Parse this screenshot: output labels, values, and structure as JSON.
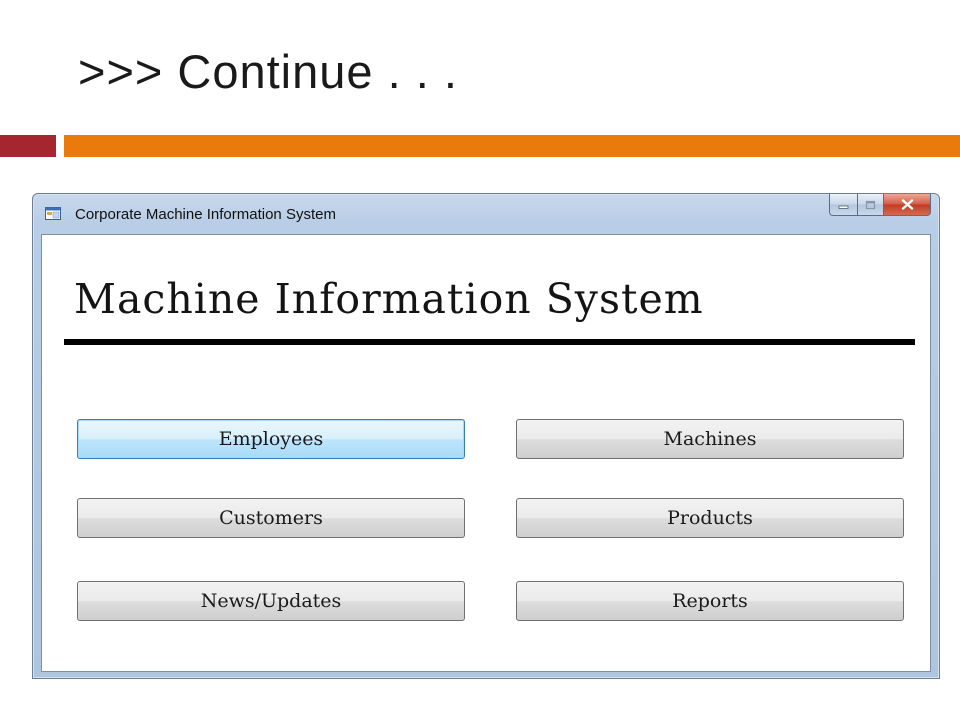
{
  "slide": {
    "title": ">>> Continue . . .",
    "colors": {
      "accent_left": "#a6262f",
      "accent_right": "#ea7a0c"
    }
  },
  "window": {
    "title": "Corporate Machine Information System",
    "app_icon": "application-form-icon",
    "controls": {
      "minimize_icon": "minimize-icon",
      "maximize_icon": "maximize-icon",
      "close_icon": "close-icon"
    }
  },
  "app": {
    "heading": "Machine Information System",
    "buttons": {
      "employees": "Employees",
      "machines": "Machines",
      "customers": "Customers",
      "products": "Products",
      "news_updates": "News/Updates",
      "reports": "Reports"
    }
  }
}
